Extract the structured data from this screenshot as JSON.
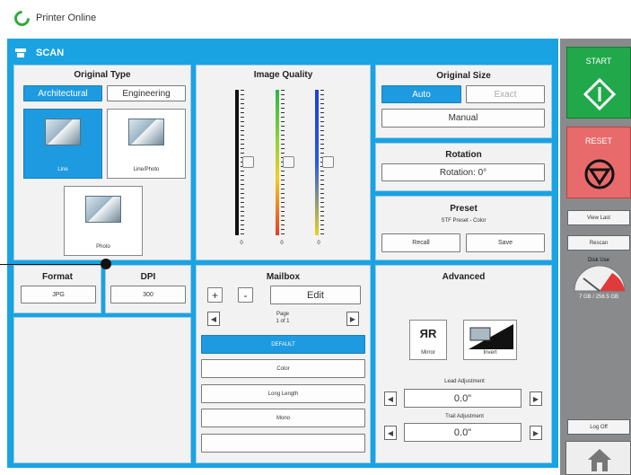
{
  "status": {
    "text": "Printer Online",
    "icon": "online-status-icon",
    "color": "#2eaa3a"
  },
  "scan": {
    "title": "SCAN",
    "icon": "scanner-icon"
  },
  "original_type": {
    "title": "Original Type",
    "tabs": [
      "Architectural",
      "Engineering"
    ],
    "selected_tab": "Architectural",
    "thumbs": [
      {
        "label": "Line",
        "selected": true
      },
      {
        "label": "Line/Photo",
        "selected": false
      },
      {
        "label": "Photo",
        "selected": false
      }
    ]
  },
  "image_quality": {
    "title": "Image Quality",
    "sliders": [
      {
        "name": "black",
        "color": "#111111",
        "value": "0",
        "level": 0.5
      },
      {
        "name": "spectrum",
        "color": "#2fb34a",
        "value": "0",
        "level": 0.5
      },
      {
        "name": "blue",
        "color": "#1f3fd6",
        "value": "0",
        "level": 0.5
      }
    ]
  },
  "original_size": {
    "title": "Original Size",
    "auto": "Auto",
    "exact": "Exact",
    "manual": "Manual"
  },
  "rotation": {
    "title": "Rotation",
    "value": "Rotation: 0°"
  },
  "preset": {
    "title": "Preset",
    "subtitle": "STF Preset - Color",
    "recall": "Recall",
    "save": "Save"
  },
  "format": {
    "title": "Format",
    "value": "JPG"
  },
  "dpi": {
    "title": "DPI",
    "value": "300"
  },
  "mailbox": {
    "title": "Mailbox",
    "plus": "+",
    "minus": "-",
    "edit": "Edit",
    "page_label": "Page",
    "page_value": "1 of 1",
    "items": [
      "DEFAULT",
      "Color",
      "Long Length",
      "Mono",
      ""
    ],
    "selected_item": "DEFAULT"
  },
  "advanced": {
    "title": "Advanced",
    "mirror": "Mirror",
    "invert": "Invert",
    "lead_label": "Lead Adjustment",
    "lead_value": "0.0\"",
    "trail_label": "Trail Adjustment",
    "trail_value": "0.0\""
  },
  "side": {
    "start": "START",
    "reset": "RESET",
    "view_last": "View Last",
    "rescan": "Rescan",
    "disk_use_label": "Disk Use",
    "disk_use_value": "7 GB / 256.5 GB",
    "log_off": "Log Off",
    "start_color": "#21a84a",
    "reset_color": "#e86a6a"
  }
}
